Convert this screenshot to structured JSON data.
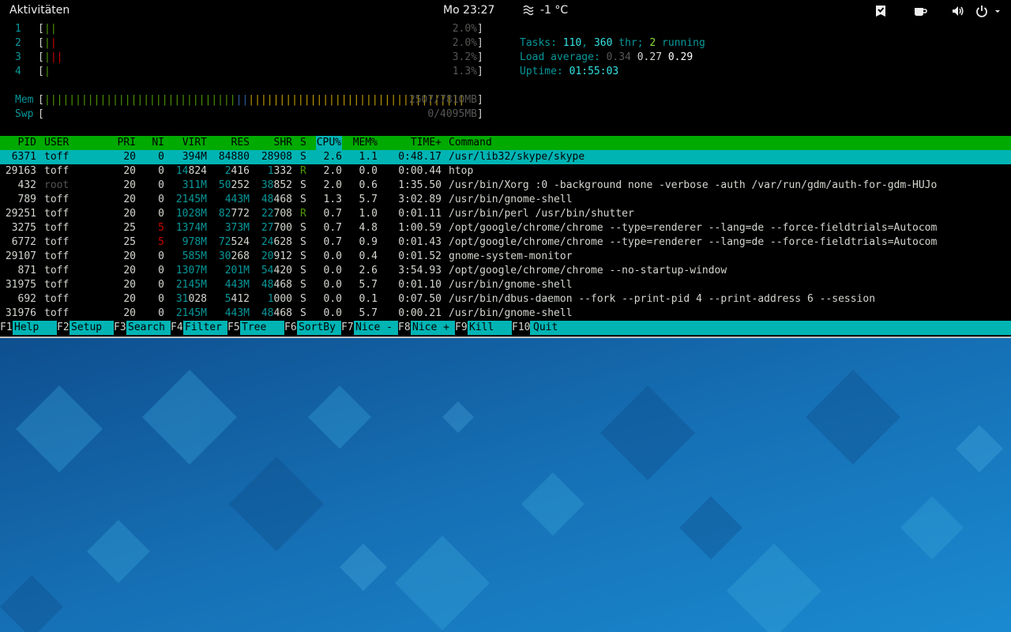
{
  "topbar": {
    "activities": "Aktivitäten",
    "clock": "Mo 23:27",
    "weather_icon": "fog-icon",
    "weather": "-1 °C",
    "tray_icons": [
      "tasks-check-icon",
      "coffee-cup-icon",
      "volume-icon",
      "power-icon",
      "chevron-down-icon"
    ]
  },
  "htop": {
    "cpus": [
      {
        "label": "1",
        "bar_green": "||",
        "bar_red": "",
        "percent": "2.0%"
      },
      {
        "label": "2",
        "bar_green": "|",
        "bar_red": "|",
        "percent": "2.0%"
      },
      {
        "label": "3",
        "bar_green": "|",
        "bar_red": "||",
        "percent": "3.2%"
      },
      {
        "label": "4",
        "bar_green": "|",
        "bar_red": "",
        "percent": "1.3%"
      }
    ],
    "mem": {
      "label": "Mem",
      "bar_green": "|||||||||||||||||||||||||||||||",
      "bar_blue": "||",
      "bar_yellow": "|||||||||||||||||||||||||||||||||||",
      "value": "2507/7810MB"
    },
    "swp": {
      "label": "Swp",
      "value": "0/4095MB"
    },
    "tasks": {
      "label": "Tasks: ",
      "tasks": "110",
      "sep": ", ",
      "threads": "360",
      "thr_label": " thr; ",
      "running": "2",
      "running_label": " running"
    },
    "load": {
      "label": "Load average: ",
      "l1": "0.34",
      "l5": "0.27",
      "l15": "0.29"
    },
    "uptime": {
      "label": "Uptime: ",
      "value": "01:55:03"
    },
    "columns": [
      "PID",
      "USER",
      "PRI",
      "NI",
      "VIRT",
      "RES",
      "SHR",
      "S",
      "CPU%",
      "MEM%",
      "TIME+",
      "Command"
    ],
    "processes": [
      {
        "pid": "6371",
        "user": "toff",
        "pri": "20",
        "ni": "0",
        "virt": "394M",
        "res": "84880",
        "shr": "28908",
        "s": "S",
        "cpu": "2.6",
        "mem": "1.1",
        "time": "0:48.17",
        "command": "/usr/lib32/skype/skype"
      },
      {
        "pid": "29163",
        "user": "toff",
        "pri": "20",
        "ni": "0",
        "virt": "14824",
        "res": "2416",
        "shr": "1332",
        "s": "R",
        "cpu": "2.0",
        "mem": "0.0",
        "time": "0:00.44",
        "command": "htop"
      },
      {
        "pid": "432",
        "user": "root",
        "pri": "20",
        "ni": "0",
        "virt": "311M",
        "res": "50252",
        "shr": "38852",
        "s": "S",
        "cpu": "2.0",
        "mem": "0.6",
        "time": "1:35.50",
        "command": "/usr/bin/Xorg :0 -background none -verbose -auth /var/run/gdm/auth-for-gdm-HUJo"
      },
      {
        "pid": "789",
        "user": "toff",
        "pri": "20",
        "ni": "0",
        "virt": "2145M",
        "res": "443M",
        "shr": "48468",
        "s": "S",
        "cpu": "1.3",
        "mem": "5.7",
        "time": "3:02.89",
        "command": "/usr/bin/gnome-shell"
      },
      {
        "pid": "29251",
        "user": "toff",
        "pri": "20",
        "ni": "0",
        "virt": "1028M",
        "res": "82772",
        "shr": "22708",
        "s": "R",
        "cpu": "0.7",
        "mem": "1.0",
        "time": "0:01.11",
        "command": "/usr/bin/perl /usr/bin/shutter"
      },
      {
        "pid": "3275",
        "user": "toff",
        "pri": "25",
        "ni": "5",
        "virt": "1374M",
        "res": "373M",
        "shr": "27700",
        "s": "S",
        "cpu": "0.7",
        "mem": "4.8",
        "time": "1:00.59",
        "command": "/opt/google/chrome/chrome --type=renderer --lang=de --force-fieldtrials=Autocom"
      },
      {
        "pid": "6772",
        "user": "toff",
        "pri": "25",
        "ni": "5",
        "virt": "978M",
        "res": "72524",
        "shr": "24628",
        "s": "S",
        "cpu": "0.7",
        "mem": "0.9",
        "time": "0:01.43",
        "command": "/opt/google/chrome/chrome --type=renderer --lang=de --force-fieldtrials=Autocom"
      },
      {
        "pid": "29107",
        "user": "toff",
        "pri": "20",
        "ni": "0",
        "virt": "585M",
        "res": "30268",
        "shr": "20912",
        "s": "S",
        "cpu": "0.0",
        "mem": "0.4",
        "time": "0:01.52",
        "command": "gnome-system-monitor"
      },
      {
        "pid": "871",
        "user": "toff",
        "pri": "20",
        "ni": "0",
        "virt": "1307M",
        "res": "201M",
        "shr": "54420",
        "s": "S",
        "cpu": "0.0",
        "mem": "2.6",
        "time": "3:54.93",
        "command": "/opt/google/chrome/chrome --no-startup-window"
      },
      {
        "pid": "31975",
        "user": "toff",
        "pri": "20",
        "ni": "0",
        "virt": "2145M",
        "res": "443M",
        "shr": "48468",
        "s": "S",
        "cpu": "0.0",
        "mem": "5.7",
        "time": "0:01.10",
        "command": "/usr/bin/gnome-shell"
      },
      {
        "pid": "692",
        "user": "toff",
        "pri": "20",
        "ni": "0",
        "virt": "31028",
        "res": "5412",
        "shr": "1000",
        "s": "S",
        "cpu": "0.0",
        "mem": "0.1",
        "time": "0:07.50",
        "command": "/usr/bin/dbus-daemon --fork --print-pid 4 --print-address 6 --session"
      },
      {
        "pid": "31976",
        "user": "toff",
        "pri": "20",
        "ni": "0",
        "virt": "2145M",
        "res": "443M",
        "shr": "48468",
        "s": "S",
        "cpu": "0.0",
        "mem": "5.7",
        "time": "0:00.21",
        "command": "/usr/bin/gnome-shell"
      }
    ],
    "fkeys": [
      {
        "key": "F1",
        "label": "Help  "
      },
      {
        "key": "F2",
        "label": "Setup "
      },
      {
        "key": "F3",
        "label": "Search"
      },
      {
        "key": "F4",
        "label": "Filter"
      },
      {
        "key": "F5",
        "label": "Tree  "
      },
      {
        "key": "F6",
        "label": "SortBy"
      },
      {
        "key": "F7",
        "label": "Nice -"
      },
      {
        "key": "F8",
        "label": "Nice +"
      },
      {
        "key": "F9",
        "label": "Kill  "
      },
      {
        "key": "F10",
        "label": "Quit"
      }
    ]
  },
  "colors": {
    "header_bg": "#00aa00",
    "selection_bg": "#00b4b4",
    "wallpaper": "#1466ab"
  }
}
